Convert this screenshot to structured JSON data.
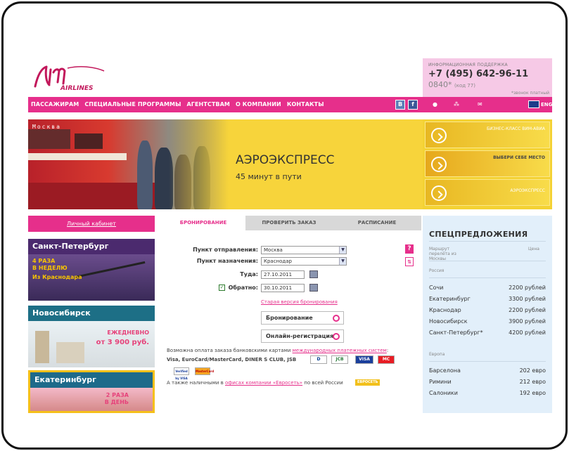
{
  "header": {
    "logo_text": "AIRLINES",
    "support_title": "ИНФОРМАЦИОННАЯ ПОДДЕРЖКА",
    "support_phone": "+7 (495) 642-96-11",
    "support_short": "0840*",
    "support_short_code": "(код 77)",
    "support_note": "*звонок платный"
  },
  "nav": {
    "items": [
      "ПАССАЖИРАМ",
      "СПЕЦИАЛЬНЫЕ ПРОГРАММЫ",
      "АГЕНТСТВАМ",
      "О КОМПАНИИ",
      "КОНТАКТЫ"
    ],
    "social_b": "В",
    "social_f": "f",
    "lang": "ENG"
  },
  "banner": {
    "train_sign": "Москва",
    "title": "АЭРОЭКСПРЕСС",
    "subtitle": "45 минут в пути"
  },
  "side_ads": [
    "БИЗНЕС-КЛАСС ВИМ-АВИА",
    "ВЫБЕРИ СЕБЕ МЕСТО",
    "АЭРОЭКСПРЕСС"
  ],
  "cabinet_link": "Личный кабинет",
  "cities": [
    {
      "name": "Санкт-Петербург",
      "line1": "4 РАЗА",
      "line2": "В НЕДЕЛЮ",
      "line3": "Из Краснодара"
    },
    {
      "name": "Новосибирск",
      "line1": "ЕЖЕДНЕВНО",
      "line2": "от 3 900 руб."
    },
    {
      "name": "Екатеринбург",
      "line1": "2 РАЗА",
      "line2": "В ДЕНЬ"
    }
  ],
  "tabs": [
    "БРОНИРОВАНИЕ",
    "ПРОВЕРИТЬ ЗАКАЗ",
    "РАСПИСАНИЕ"
  ],
  "booking": {
    "from_label": "Пункт отправления:",
    "from_value": "Москва",
    "to_label": "Пункт назначения:",
    "to_value": "Краснодар",
    "there_label": "Туда:",
    "there_date": "27.10.2011",
    "back_label": "Обратно:",
    "back_date": "30.10.2011",
    "old_version_link": "Старая версия бронирования",
    "book_button": "Бронирование",
    "checkin_button": "Онлайн-регистрация",
    "pay_text_1": "Возможна оплата заказа банковскими картами ",
    "pay_link": "международных платежных систем",
    "pay_text_2": ":",
    "cards_text": "Visa, EuroCard/MasterCard, DINER S CLUB, JSB",
    "cash_text_1": "А также наличными в ",
    "cash_link": "офисах компании «Евросеть»",
    "cash_text_2": " по всей России",
    "evroset": "ЕВРОСЕТЬ",
    "card_labels": [
      "D",
      "JCB",
      "VISA",
      "MC"
    ],
    "small_cards": [
      "Verified by VISA",
      "MasterCard"
    ]
  },
  "offers": {
    "title": "СПЕЦПРЕДЛОЖЕНИЯ",
    "col_route": "Маршрут перелёта из Москвы",
    "col_price": "Цена",
    "group_russia": "Россия",
    "russia": [
      {
        "city": "Сочи",
        "price": "2200 рублей"
      },
      {
        "city": "Екатеринбург",
        "price": "3300 рублей"
      },
      {
        "city": "Краснодар",
        "price": "2200 рублей"
      },
      {
        "city": "Новосибирск",
        "price": "3900 рублей"
      },
      {
        "city": "Санкт-Петербург*",
        "price": "4200 рублей"
      }
    ],
    "group_europe": "Европа",
    "europe": [
      {
        "city": "Барселона",
        "price": "202 евро"
      },
      {
        "city": "Римини",
        "price": "212 евро"
      },
      {
        "city": "Салоники",
        "price": "192 евро"
      }
    ]
  },
  "colors": {
    "brand_pink": "#e62f8b",
    "banner_yellow": "#f7d43b",
    "offers_bg": "#e2effa"
  }
}
